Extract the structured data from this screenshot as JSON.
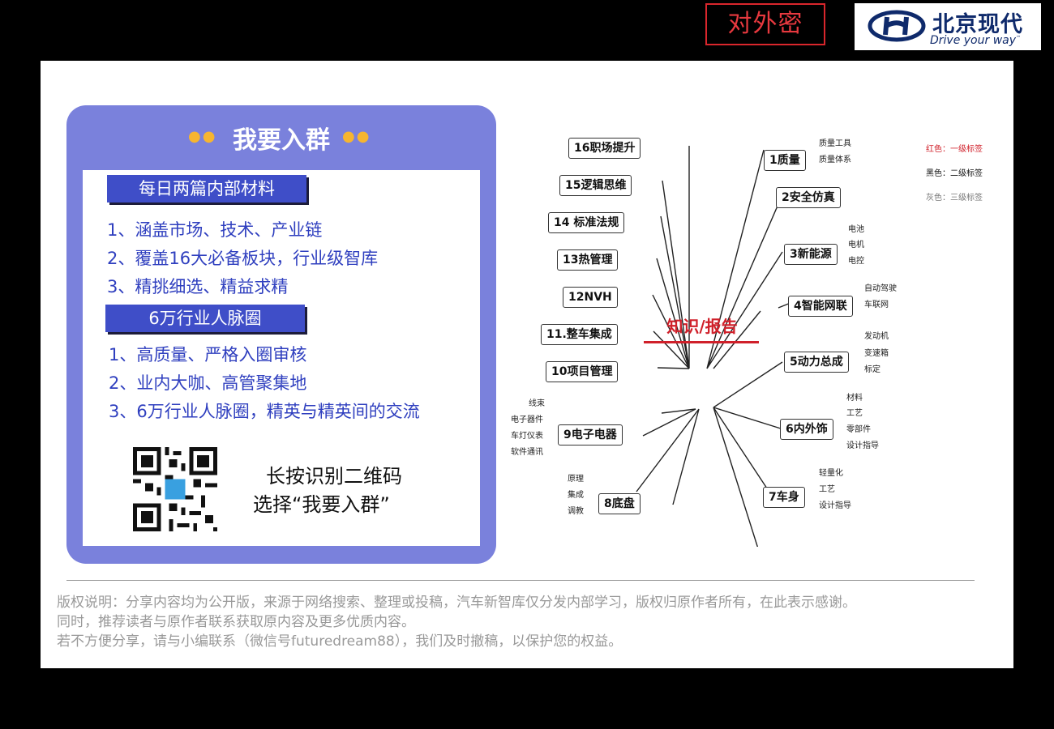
{
  "header": {
    "stamp": "对外密",
    "logo_zh": "北京现代",
    "logo_en": "Drive your way",
    "logo_tm": "™"
  },
  "card": {
    "title": "我要入群",
    "section1_title": "每日两篇内部材料",
    "section1_items": [
      "1、涵盖市场、技术、产业链",
      "2、覆盖16大必备板块，行业级智库",
      "3、精挑细选、精益求精"
    ],
    "section2_title": "6万行业人脉圈",
    "section2_items": [
      "1、高质量、严格入圈审核",
      "2、业内大咖、高管聚集地",
      "3、6万行业人脉圈，精英与精英间的交流"
    ],
    "qr_caption_line1": "长按识别二维码",
    "qr_caption_line2": "选择“我要入群”"
  },
  "mindmap": {
    "center": "知识/报告",
    "left_nodes": [
      "16职场提升",
      "15逻辑思维",
      "14 标准法规",
      "13热管理",
      "12NVH",
      "11.整车集成",
      "10项目管理",
      "9电子电器",
      "8底盘"
    ],
    "right_nodes": [
      "1质量",
      "2安全仿真",
      "3新能源",
      "4智能网联",
      "5动力总成",
      "6内外饰",
      "7车身"
    ],
    "leaves": {
      "quality": [
        "质量工具",
        "质量体系"
      ],
      "new_energy": [
        "电池",
        "电机",
        "电控"
      ],
      "smart": [
        "自动驾驶",
        "车联网"
      ],
      "powertrain": [
        "发动机",
        "变速箱",
        "标定"
      ],
      "interior": [
        "材料",
        "工艺",
        "零部件",
        "设计指导"
      ],
      "body": [
        "轻量化",
        "工艺",
        "设计指导"
      ],
      "chassis": [
        "原理",
        "集成",
        "调教"
      ],
      "electronics": [
        "线束",
        "电子器件",
        "车灯仪表",
        "软件通讯"
      ]
    },
    "legend": [
      "红色：一级标签",
      "黑色：二级标签",
      "灰色：三级标签"
    ]
  },
  "copyright": {
    "line1": "版权说明：分享内容均为公开版，来源于网络搜索、整理或投稿，汽车新智库仅分发内部学习，版权归原作者所有，在此表示感谢。",
    "line2": "同时，推荐读者与原作者联系获取原内容及更多优质内容。",
    "line3": "若不方便分享，请与小编联系（微信号futuredream88），我们及时撤稿，以保护您的权益。"
  },
  "colors": {
    "card": "#7a81dc",
    "bar": "#3f4ec8",
    "accent_red": "#d0202a",
    "text_blue": "#2f3fbf"
  }
}
